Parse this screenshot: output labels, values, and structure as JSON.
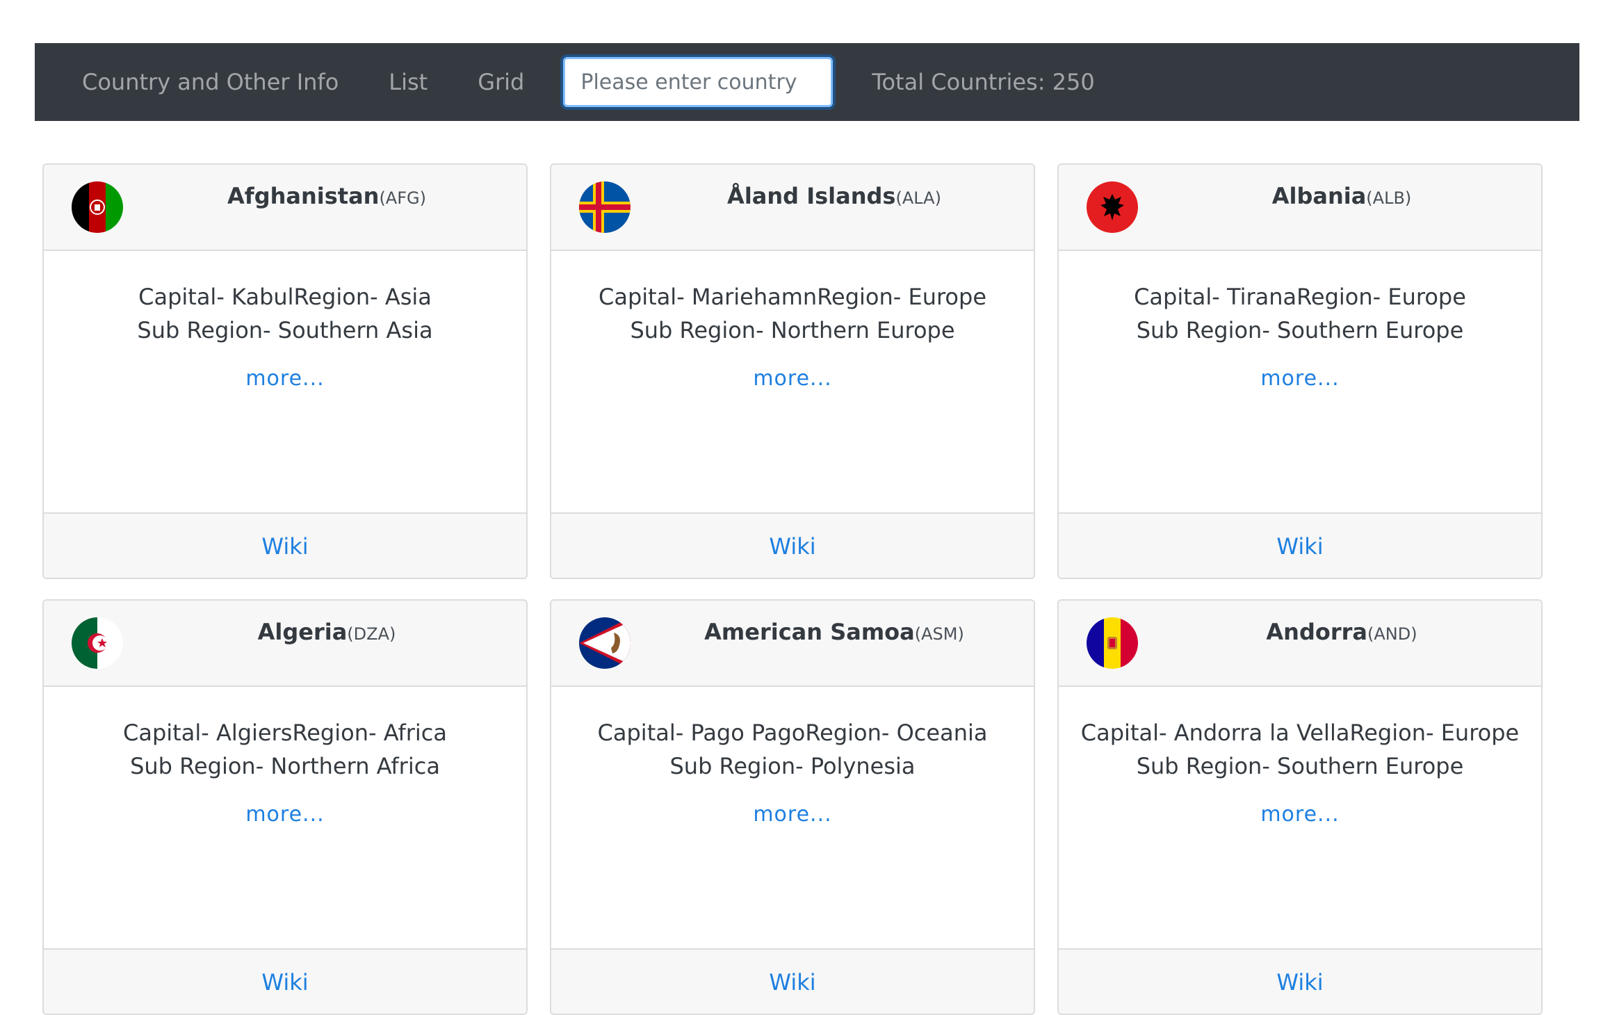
{
  "navbar": {
    "brand": "Country and Other Info",
    "list_label": "List",
    "grid_label": "Grid",
    "search_placeholder": "Please enter country",
    "total_text": "Total Countries: 250"
  },
  "countries": [
    {
      "name": "Afghanistan",
      "code": "(AFG)",
      "capital_line": "Capital- KabulRegion- Asia",
      "subregion_line": "Sub Region- Southern Asia",
      "more": "more...",
      "wiki": "Wiki"
    },
    {
      "name": "Åland Islands",
      "code": "(ALA)",
      "capital_line": "Capital- MariehamnRegion- Europe",
      "subregion_line": "Sub Region- Northern Europe",
      "more": "more...",
      "wiki": "Wiki"
    },
    {
      "name": "Albania",
      "code": "(ALB)",
      "capital_line": "Capital- TiranaRegion- Europe",
      "subregion_line": "Sub Region- Southern Europe",
      "more": "more...",
      "wiki": "Wiki"
    },
    {
      "name": "Algeria",
      "code": "(DZA)",
      "capital_line": "Capital- AlgiersRegion- Africa",
      "subregion_line": "Sub Region- Northern Africa",
      "more": "more...",
      "wiki": "Wiki"
    },
    {
      "name": "American Samoa",
      "code": "(ASM)",
      "capital_line": "Capital- Pago PagoRegion- Oceania",
      "subregion_line": "Sub Region- Polynesia",
      "more": "more...",
      "wiki": "Wiki"
    },
    {
      "name": "Andorra",
      "code": "(AND)",
      "capital_line": "Capital- Andorra la VellaRegion- Europe",
      "subregion_line": "Sub Region- Southern Europe",
      "more": "more...",
      "wiki": "Wiki"
    }
  ],
  "colors": {
    "navbar_bg": "#343a40",
    "link": "#1d7fe0",
    "card_header_bg": "#f7f7f7"
  }
}
